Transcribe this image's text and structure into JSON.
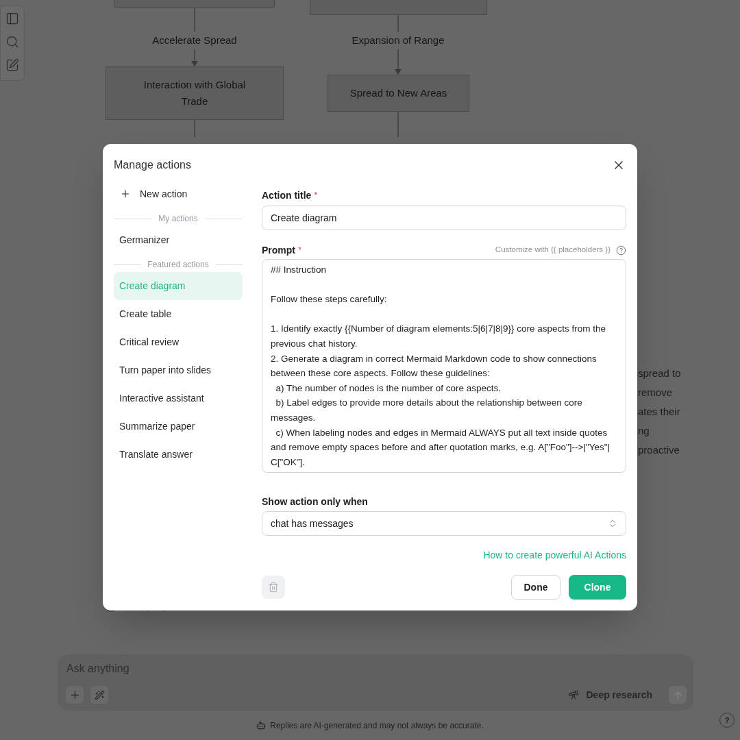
{
  "diagram": {
    "nodes": [
      {
        "label": "Interaction with Global Trade"
      },
      {
        "label": "Spread to New Areas"
      }
    ],
    "edge_labels": [
      "Accelerate Spread",
      "Expansion of Range"
    ]
  },
  "answer_fragments": [
    "spread to",
    "remove",
    "ates their",
    "ng",
    "proactive"
  ],
  "composer": {
    "placeholder": "Ask anything",
    "deep_research": "Deep research"
  },
  "footer": {
    "disclaimer": "Replies are AI-generated and may not always be accurate.",
    "help": "?"
  },
  "dialog": {
    "title": "Manage actions",
    "new_action": "New action",
    "sections": [
      {
        "heading": "My actions",
        "items": [
          {
            "label": "Germanizer",
            "selected": false
          }
        ]
      },
      {
        "heading": "Featured actions",
        "items": [
          {
            "label": "Create diagram",
            "selected": true
          },
          {
            "label": "Create table",
            "selected": false
          },
          {
            "label": "Critical review",
            "selected": false
          },
          {
            "label": "Turn paper into slides",
            "selected": false
          },
          {
            "label": "Interactive assistant",
            "selected": false
          },
          {
            "label": "Summarize paper",
            "selected": false
          },
          {
            "label": "Translate answer",
            "selected": false
          }
        ]
      }
    ],
    "title_field": {
      "label": "Action title",
      "required_mark": "*",
      "value": "Create diagram"
    },
    "prompt_field": {
      "label": "Prompt",
      "required_mark": "*",
      "hint": "Customize with {{ placeholders }}",
      "value": "## Instruction\n\nFollow these steps carefully:\n\n1. Identify exactly {{Number of diagram elements:5|6|7|8|9}} core aspects from the previous chat history.\n2. Generate a diagram in correct Mermaid Markdown code to show connections between these core aspects. Follow these guidelines:\n  a) The number of nodes is the number of core aspects.\n  b) Label edges to provide more details about the relationship between core messages.\n  c) When labeling nodes and edges in Mermaid ALWAYS put all text inside quotes and remove empty spaces before and after quotation marks, e.g. A[\"Foo\"]-->|\"Yes\"| C[\"OK\"]."
    },
    "condition_field": {
      "label": "Show action only when",
      "value": "chat has messages"
    },
    "help_link": "How to create powerful AI Actions",
    "done": "Done",
    "clone": "Clone"
  }
}
